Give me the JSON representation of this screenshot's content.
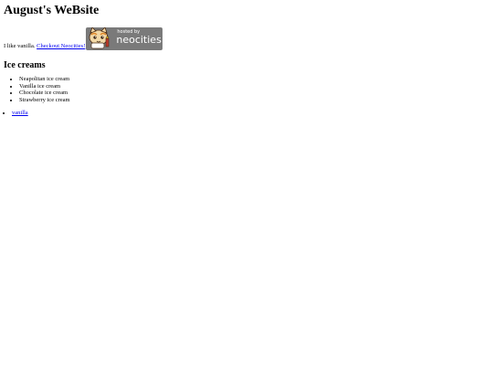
{
  "page": {
    "title": "August's WeBsite",
    "intro_text": "I like vanilla.",
    "intro_link": "Checkout Neocities!"
  },
  "badge": {
    "icon": "neocities-cat-icon",
    "hosted_text": "hosted by",
    "brand_text": "neocities",
    "background_color": "#7a7a7a"
  },
  "ice_creams": {
    "heading": "Ice creams",
    "items": [
      "Neapolitan ice cream",
      "Vanilla ice cream",
      "Chocolate ice cream",
      "Strawberry ice cream"
    ]
  },
  "links": {
    "items": [
      "vanilla"
    ]
  },
  "colors": {
    "link": "#0000ee",
    "text": "#000000",
    "background": "#ffffff"
  }
}
